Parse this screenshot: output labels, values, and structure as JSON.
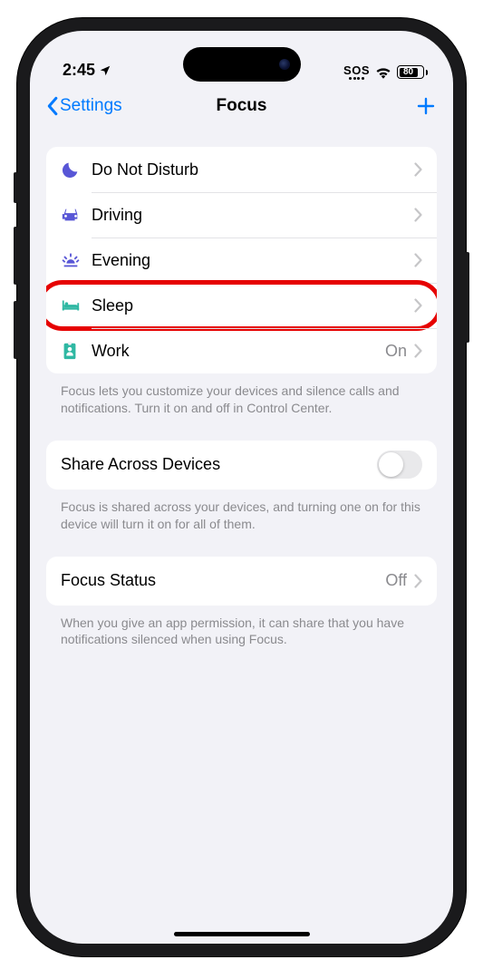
{
  "status": {
    "time": "2:45",
    "sos": "SOS",
    "battery": "80"
  },
  "nav": {
    "back": "Settings",
    "title": "Focus"
  },
  "focus_list": [
    {
      "icon": "moon",
      "label": "Do Not Disturb",
      "value": "",
      "color": "#5856d6"
    },
    {
      "icon": "car",
      "label": "Driving",
      "value": "",
      "color": "#5856d6"
    },
    {
      "icon": "sunset",
      "label": "Evening",
      "value": "",
      "color": "#5856d6"
    },
    {
      "icon": "bed",
      "label": "Sleep",
      "value": "",
      "color": "#2fb8a3",
      "highlighted": true
    },
    {
      "icon": "badge",
      "label": "Work",
      "value": "On",
      "color": "#2fb8a3"
    }
  ],
  "focus_footer": "Focus lets you customize your devices and silence calls and notifications. Turn it on and off in Control Center.",
  "share": {
    "label": "Share Across Devices",
    "on": false,
    "footer": "Focus is shared across your devices, and turning one on for this device will turn it on for all of them."
  },
  "status_row": {
    "label": "Focus Status",
    "value": "Off",
    "footer": "When you give an app permission, it can share that you have notifications silenced when using Focus."
  }
}
